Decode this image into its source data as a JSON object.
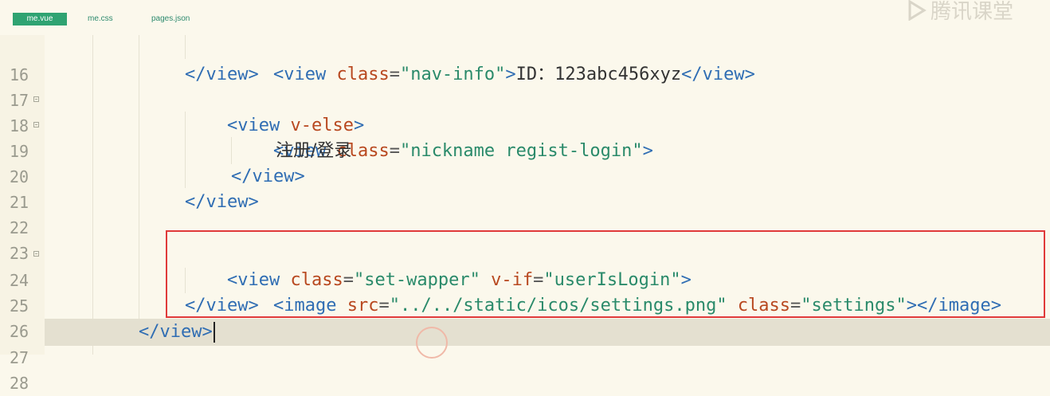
{
  "tabs": [
    {
      "label": "me.vue",
      "active": true
    },
    {
      "label": "me.css",
      "active": false
    },
    {
      "label": "pages.json",
      "active": false
    }
  ],
  "watermark": {
    "text": "腾讯课堂",
    "icon": "play-icon"
  },
  "lines": [
    {
      "num": "16",
      "fold": false
    },
    {
      "num": "17",
      "fold": false
    },
    {
      "num": "18",
      "fold": true
    },
    {
      "num": "19",
      "fold": true
    },
    {
      "num": "20",
      "fold": false
    },
    {
      "num": "21",
      "fold": false
    },
    {
      "num": "22",
      "fold": false
    },
    {
      "num": "23",
      "fold": false
    },
    {
      "num": "24",
      "fold": true
    },
    {
      "num": "25",
      "fold": false
    },
    {
      "num": "26",
      "fold": false
    },
    {
      "num": "27",
      "fold": false
    },
    {
      "num": "28",
      "fold": false
    }
  ],
  "code": {
    "l16": {
      "open": "<view",
      "attr": "class",
      "eq": "=",
      "val": "\"nav-info\"",
      "close": ">",
      "text": "ID：123abc456xyz",
      "end": "</view>"
    },
    "l17": {
      "end": "</view>"
    },
    "l18": {
      "open": "<view",
      "attr": "v-else",
      "close": ">"
    },
    "l19": {
      "open": "<view",
      "attr": "class",
      "eq": "=",
      "val": "\"nickname regist-login\"",
      "close": ">"
    },
    "l20": {
      "text": "注册/登录"
    },
    "l21": {
      "end": "</view>"
    },
    "l22": {
      "end": "</view>"
    },
    "l24": {
      "open": "<view",
      "attr1": "class",
      "eq": "=",
      "val1": "\"set-wapper\"",
      "attr2": "v-if",
      "val2": "\"userIsLogin\"",
      "close": ">"
    },
    "l25": {
      "open": "<image",
      "attr1": "src",
      "eq": "=",
      "val1": "\"../../static/icos/settings.png\"",
      "attr2": "class",
      "val2": "\"settings\"",
      "close": ">",
      "end": "</image>"
    },
    "l26": {
      "end": "</view>"
    },
    "l27": {
      "end": "</view>"
    }
  }
}
